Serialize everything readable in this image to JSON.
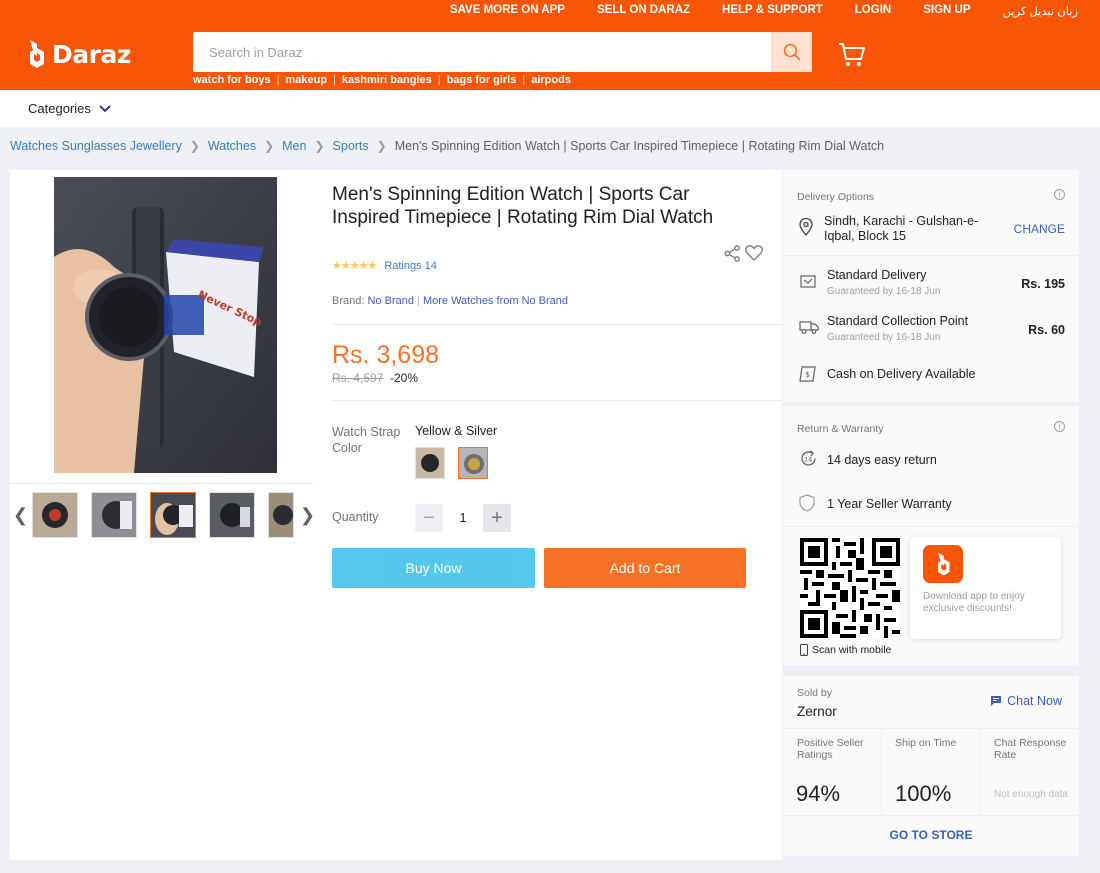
{
  "header": {
    "top_links": [
      "SAVE MORE ON APP",
      "SELL ON DARAZ",
      "HELP & SUPPORT",
      "LOGIN",
      "SIGN UP",
      "زبان تبدیل کریں"
    ],
    "logo_text": "Daraz",
    "search_placeholder": "Search in Daraz",
    "quick_links": [
      "watch for boys",
      "makeup",
      "kashmiri bangles",
      "bags for girls",
      "airpods"
    ],
    "brand_color": "#f85606"
  },
  "categories_label": "Categories",
  "breadcrumb": {
    "items": [
      "Watches Sunglasses Jewellery",
      "Watches",
      "Men",
      "Sports"
    ],
    "current": "Men's Spinning Edition Watch | Sports Car Inspired Timepiece | Rotating Rim Dial Watch"
  },
  "product": {
    "title": "Men's Spinning Edition Watch | Sports Car Inspired Timepiece | Rotating Rim Dial Watch",
    "ratings_text": "Ratings 14",
    "stars": 4.5,
    "brand_label": "Brand:",
    "brand_name": "No Brand",
    "more_from": "More Watches from No Brand",
    "price": "Rs. 3,698",
    "old_price": "Rs. 4,597",
    "discount": "-20%",
    "variant_label": "Watch Strap Color",
    "variant_value": "Yellow & Silver",
    "quantity_label": "Quantity",
    "quantity": "1",
    "buy_now": "Buy Now",
    "add_to_cart": "Add to Cart",
    "image_box_text": "Never Stop"
  },
  "delivery": {
    "title": "Delivery Options",
    "location": "Sindh, Karachi - Gulshan-e-Iqbal, Block 15",
    "change": "CHANGE",
    "options": [
      {
        "name": "Standard Delivery",
        "sub": "Guaranteed by 16-18 Jun",
        "fee": "Rs. 195"
      },
      {
        "name": "Standard Collection Point",
        "sub": "Guaranteed by 16-18 Jun",
        "fee": "Rs. 60"
      }
    ],
    "cod": "Cash on Delivery Available"
  },
  "warranty": {
    "title": "Return & Warranty",
    "return_badge": "14",
    "return": "14 days easy return",
    "warranty": "1 Year Seller Warranty"
  },
  "app": {
    "scan": "Scan with mobile",
    "promo": "Download app to enjoy exclusive discounts!"
  },
  "seller": {
    "sold_by": "Sold by",
    "name": "Zernor",
    "chat": "Chat Now",
    "metrics": [
      {
        "label": "Positive Seller Ratings",
        "value": "94%"
      },
      {
        "label": "Ship on Time",
        "value": "100%"
      },
      {
        "label": "Chat Response Rate",
        "value": "Not enough data"
      }
    ],
    "go_store": "GO TO STORE"
  }
}
